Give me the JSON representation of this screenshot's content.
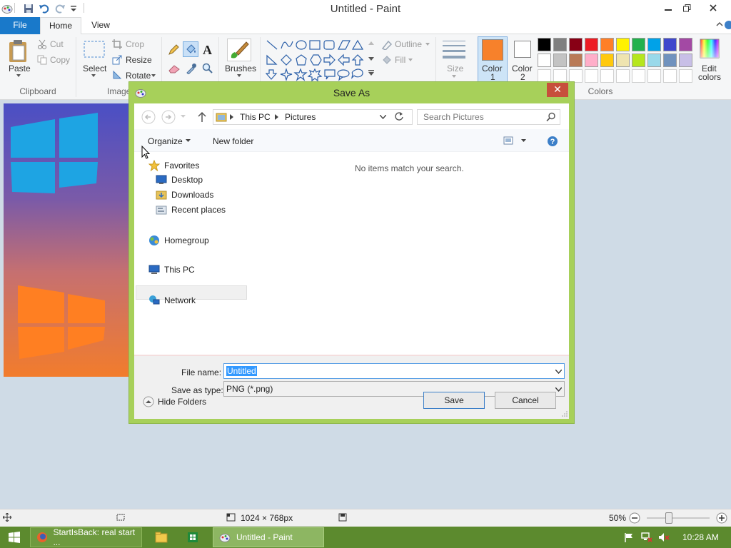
{
  "app": {
    "window_title": "Untitled - Paint"
  },
  "tabs": {
    "file": "File",
    "home": "Home",
    "view": "View"
  },
  "ribbon": {
    "clipboard": {
      "paste": "Paste",
      "cut": "Cut",
      "copy": "Copy",
      "group": "Clipboard"
    },
    "image": {
      "select": "Select",
      "crop": "Crop",
      "resize": "Resize",
      "rotate": "Rotate",
      "group": "Image"
    },
    "tools": {
      "brushes": "Brushes"
    },
    "shapes": {
      "outline": "Outline",
      "fill": "Fill"
    },
    "size": "Size",
    "color1": {
      "label_line1": "Color",
      "label_line2": "1",
      "value": "#f7812b"
    },
    "color2": {
      "label_line1": "Color",
      "label_line2": "2",
      "value": "#ffffff"
    },
    "colors_group": "Colors",
    "edit_colors": {
      "line1": "Edit",
      "line2": "colors"
    },
    "palette_row1": [
      "#000000",
      "#7f7f7f",
      "#880015",
      "#ed1c24",
      "#ff7f27",
      "#fff200",
      "#22b14c",
      "#00a2e8",
      "#3f48cc",
      "#a349a4"
    ],
    "palette_row2": [
      "#ffffff",
      "#c3c3c3",
      "#b97a57",
      "#ffaec9",
      "#ffc90e",
      "#efe4b0",
      "#b5e61d",
      "#99d9ea",
      "#7092be",
      "#c8bfe7"
    ]
  },
  "dialog": {
    "title": "Save As",
    "breadcrumb": [
      "This PC",
      "Pictures"
    ],
    "search_placeholder": "Search Pictures",
    "organize": "Organize",
    "new_folder": "New folder",
    "empty_message": "No items match your search.",
    "tree": {
      "favorites": "Favorites",
      "desktop": "Desktop",
      "downloads": "Downloads",
      "recent_places": "Recent places",
      "homegroup": "Homegroup",
      "this_pc": "This PC",
      "network": "Network"
    },
    "file_name_label": "File name:",
    "file_name_value": "Untitled",
    "save_as_type_label": "Save as type:",
    "save_as_type_value": "PNG (*.png)",
    "hide_folders": "Hide Folders",
    "save": "Save",
    "cancel": "Cancel"
  },
  "status": {
    "dimensions": "1024 × 768px",
    "zoom": "50%",
    "zoom_level": 0.5
  },
  "taskbar": {
    "items": [
      "StartIsBack: real start ...",
      "Untitled - Paint"
    ],
    "time": "10:28 AM"
  }
}
